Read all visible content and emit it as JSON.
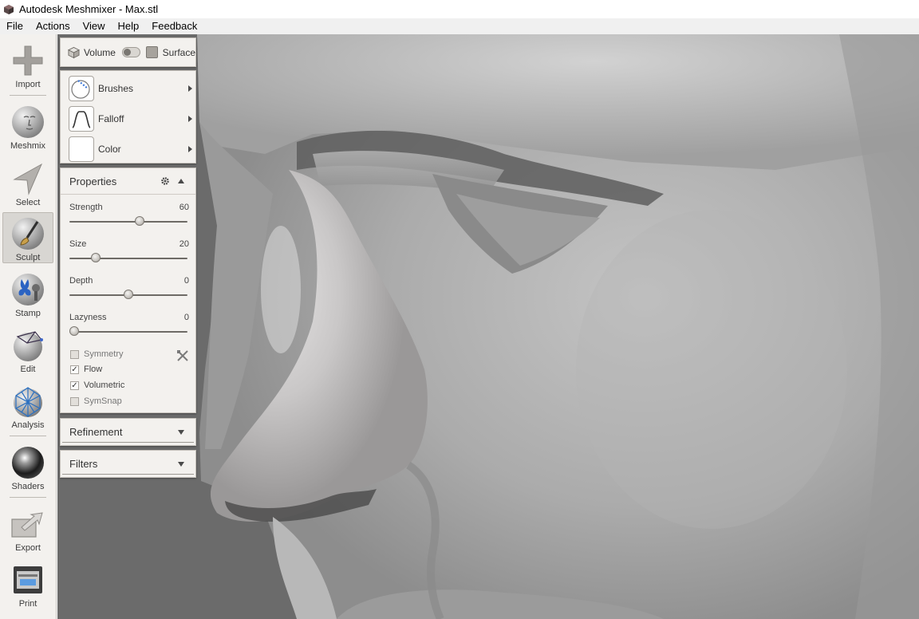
{
  "window": {
    "title": "Autodesk Meshmixer - Max.stl"
  },
  "menu": [
    "File",
    "Actions",
    "View",
    "Help",
    "Feedback"
  ],
  "toolbar": {
    "tools": [
      {
        "label": "Import",
        "icon": "plus-icon"
      },
      {
        "label": "Meshmix",
        "icon": "face-sphere-icon"
      },
      {
        "label": "Select",
        "icon": "select-arrow-icon"
      },
      {
        "label": "Sculpt",
        "icon": "sculpt-brush-icon",
        "active": true
      },
      {
        "label": "Stamp",
        "icon": "stamp-icon"
      },
      {
        "label": "Edit",
        "icon": "edit-mesh-icon"
      },
      {
        "label": "Analysis",
        "icon": "analysis-icon"
      },
      {
        "label": "Shaders",
        "icon": "shader-sphere-icon"
      },
      {
        "label": "Export",
        "icon": "export-icon"
      },
      {
        "label": "Print",
        "icon": "printer-icon"
      }
    ]
  },
  "mode": {
    "volume_label": "Volume",
    "surface_label": "Surface",
    "selected": "Volume"
  },
  "brush_panel": {
    "brushes_label": "Brushes",
    "falloff_label": "Falloff",
    "color_label": "Color",
    "color_value": "#ffffff"
  },
  "properties": {
    "title": "Properties",
    "sliders": [
      {
        "label": "Strength",
        "value": 60,
        "fraction": 0.6
      },
      {
        "label": "Size",
        "value": 20,
        "fraction": 0.2
      },
      {
        "label": "Depth",
        "value": 0,
        "fraction": 0.5
      },
      {
        "label": "Lazyness",
        "value": 0,
        "fraction": 0.0
      }
    ],
    "checkboxes": [
      {
        "label": "Symmetry",
        "checked": false
      },
      {
        "label": "Flow",
        "checked": true
      },
      {
        "label": "Volumetric",
        "checked": true
      },
      {
        "label": "SymSnap",
        "checked": false
      }
    ]
  },
  "refinement": {
    "title": "Refinement"
  },
  "filters": {
    "title": "Filters"
  },
  "colors": {
    "panel_bg": "#f3f1ee",
    "viewport_bg": "#6a6a6a",
    "mesh_base": "#a9a9a9"
  }
}
